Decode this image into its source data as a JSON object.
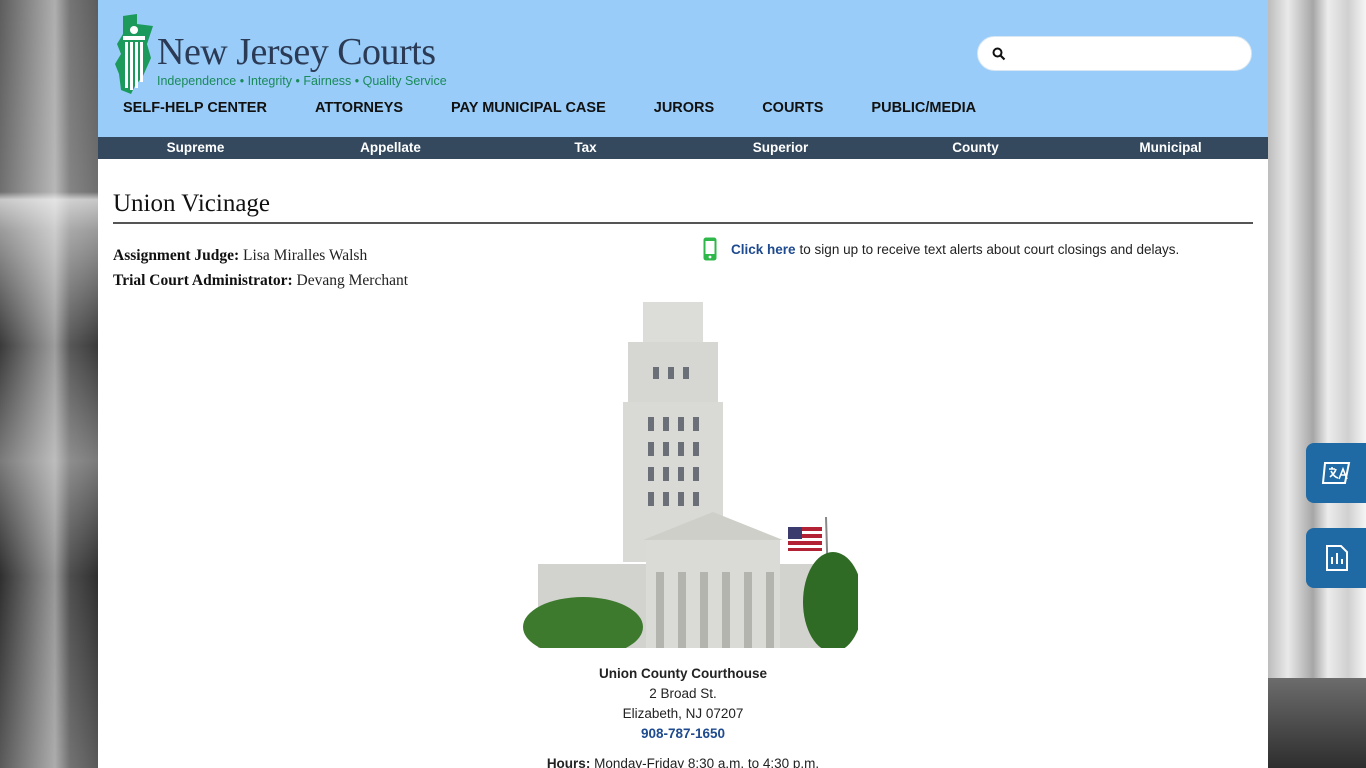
{
  "site": {
    "logo_title": "New Jersey Courts",
    "logo_tagline": "Independence • Integrity • Fairness • Quality Service"
  },
  "search": {
    "placeholder": "",
    "value": ""
  },
  "main_nav": [
    "SELF-HELP CENTER",
    "ATTORNEYS",
    "PAY MUNICIPAL CASE",
    "JURORS",
    "COURTS",
    "PUBLIC/MEDIA"
  ],
  "sub_nav": [
    "Supreme",
    "Appellate",
    "Tax",
    "Superior",
    "County",
    "Municipal"
  ],
  "page": {
    "title": "Union Vicinage",
    "assignment_judge_label": "Assignment Judge:",
    "assignment_judge_name": "Lisa Miralles Walsh",
    "tca_label": "Trial Court Administrator:",
    "tca_name": "Devang Merchant",
    "alert_link": "Click here",
    "alert_text": "to sign up to receive text alerts about court closings and delays."
  },
  "courthouse": {
    "name": "Union County Courthouse",
    "street": "2 Broad St.",
    "city": "Elizabeth, NJ 07207",
    "phone": "908-787-1650",
    "hours_label": "Hours:",
    "hours_value": "Monday-Friday 8:30 a.m. to 4:30 p.m."
  },
  "icons": {
    "search": "search-icon",
    "phone": "mobile-phone-icon",
    "side_1": "translate-icon",
    "side_2": "report-icon"
  },
  "colors": {
    "header_bg": "#99ccf8",
    "subnav_bg": "#34495e",
    "link": "#1e4a8f",
    "side_button": "#1f6aa5",
    "phone_icon": "#2eb84a"
  }
}
